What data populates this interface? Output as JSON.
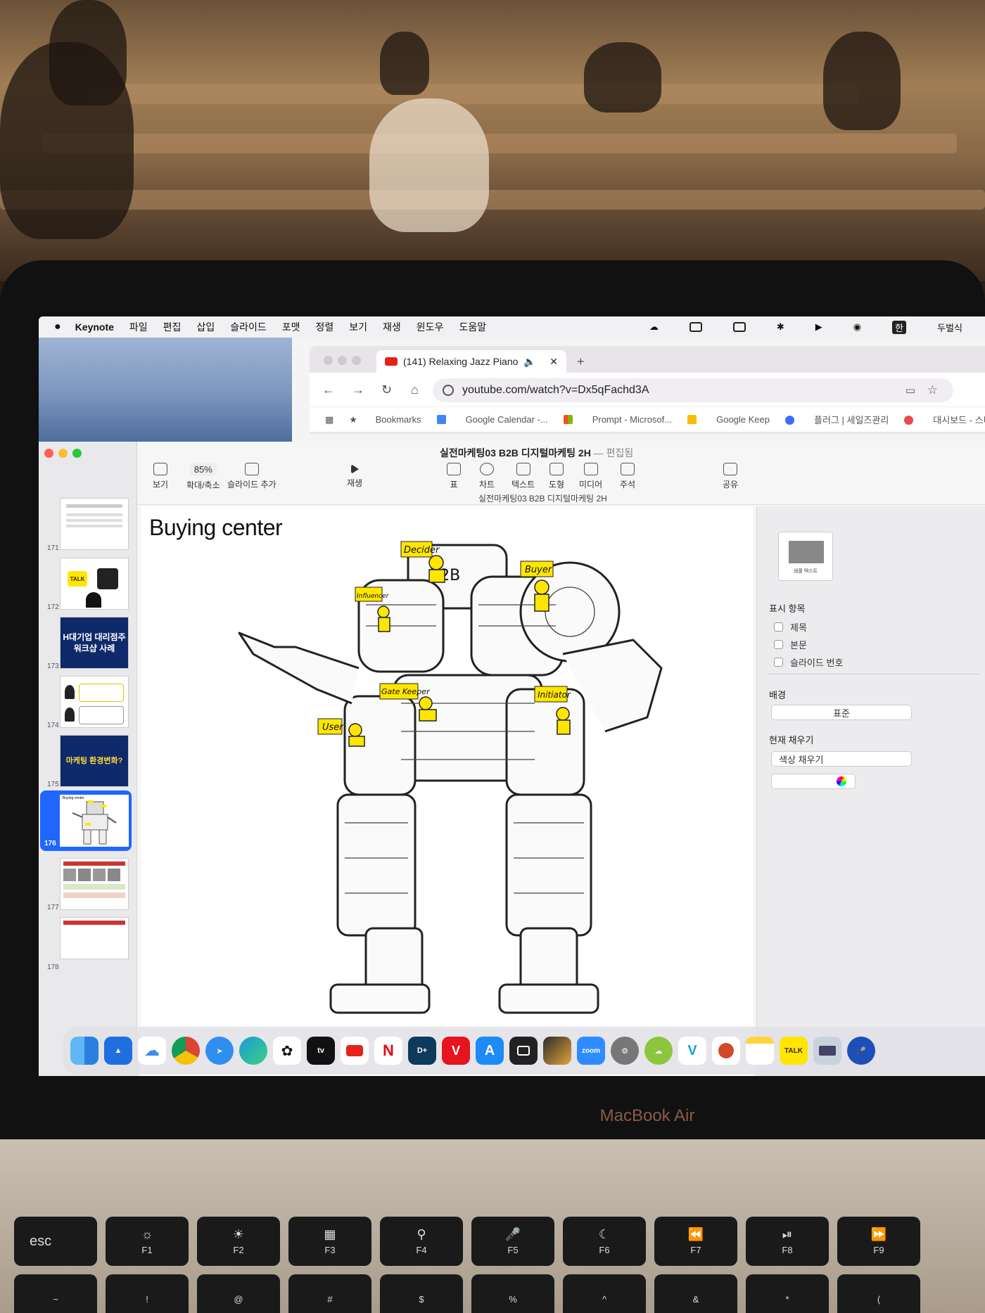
{
  "menubar": {
    "app_name": "Keynote",
    "items": [
      "파일",
      "편집",
      "삽입",
      "슬라이드",
      "포맷",
      "정렬",
      "보기",
      "재생",
      "윈도우",
      "도움말"
    ],
    "status_input_source": "한",
    "status_user": "두벌식"
  },
  "browser": {
    "tab_title": "(141) Relaxing Jazz Piano",
    "new_tab": "+",
    "url": "youtube.com/watch?v=Dx5qFachd3A",
    "bookmarks": [
      "Bookmarks",
      "Google Calendar -...",
      "Prompt - Microsof...",
      "Google Keep",
      "플러그 | 세일즈관리",
      "대시보드 - 스티비"
    ]
  },
  "keynote": {
    "doc_title": "실전마케팅03 B2B 디지털마케팅 2H",
    "doc_status": "— 편집됨",
    "doc_subtitle": "실전마케팅03 B2B 디지털마케팅 2H",
    "toolbar": {
      "view": "보기",
      "zoom_value": "85%",
      "zoom": "확대/축소",
      "add_slide": "슬라이드 추가",
      "play": "재생",
      "table": "표",
      "chart": "차트",
      "text": "텍스트",
      "shape": "도형",
      "media": "미디어",
      "comment": "주석",
      "share": "공유"
    },
    "slides": [
      {
        "num": "171",
        "text": ""
      },
      {
        "num": "172",
        "text": "TALK"
      },
      {
        "num": "173",
        "text": "H대기업 대리점주 워크샵 사례"
      },
      {
        "num": "174",
        "text": ""
      },
      {
        "num": "175",
        "text": "마케팅 환경변화?"
      },
      {
        "num": "176",
        "text": "Buying center"
      },
      {
        "num": "177",
        "text": ""
      },
      {
        "num": "178",
        "text": ""
      }
    ],
    "selected_slide": "176",
    "slide": {
      "title": "Buying center",
      "center_label": "B2B",
      "roles": [
        "Decider",
        "Buyer",
        "Influencer",
        "Gate Keeper",
        "Initiator",
        "User"
      ]
    },
    "inspector": {
      "preview_text": "샘플 텍스트",
      "show_items": "표시 항목",
      "title": "제목",
      "body": "본문",
      "slide_number": "슬라이드 번호",
      "background": "배경",
      "background_value": "표준",
      "current_fill": "현재 채우기",
      "fill_value": "색상 채우기"
    }
  },
  "dock": {
    "apps": [
      "finder-icon",
      "keynote-icon",
      "icloud-drive-icon",
      "chrome-icon",
      "safari-icon",
      "edge-icon",
      "chatgpt-icon",
      "apple-tv-icon",
      "youtube-icon",
      "netflix-icon",
      "disney-plus-icon",
      "tving-icon",
      "app-store-icon",
      "screenshot-icon",
      "final-cut-icon",
      "zoom-icon",
      "system-settings-icon",
      "cloud-app-icon",
      "v-app-icon",
      "powerpoint-icon",
      "notes-icon",
      "kakaotalk-icon",
      "printer-icon",
      "voice-icon"
    ],
    "labels": {
      "tv": "tv",
      "zoom": "zoom",
      "talk": "TALK",
      "netflix": "N"
    }
  },
  "laptop": {
    "brand": "MacBook Air",
    "keys": [
      "esc",
      "F1",
      "F2",
      "F3",
      "F4",
      "F5",
      "F6",
      "F7",
      "F8",
      "F9"
    ],
    "number_row": [
      "~",
      "!",
      "@",
      "#",
      "$",
      "%",
      "^",
      "&",
      "*",
      "("
    ]
  },
  "colors": {
    "selection_blue": "#1f66ff",
    "slide_navy": "#0e2a6b",
    "role_yellow": "#ffe600",
    "youtube_red": "#e62117"
  }
}
